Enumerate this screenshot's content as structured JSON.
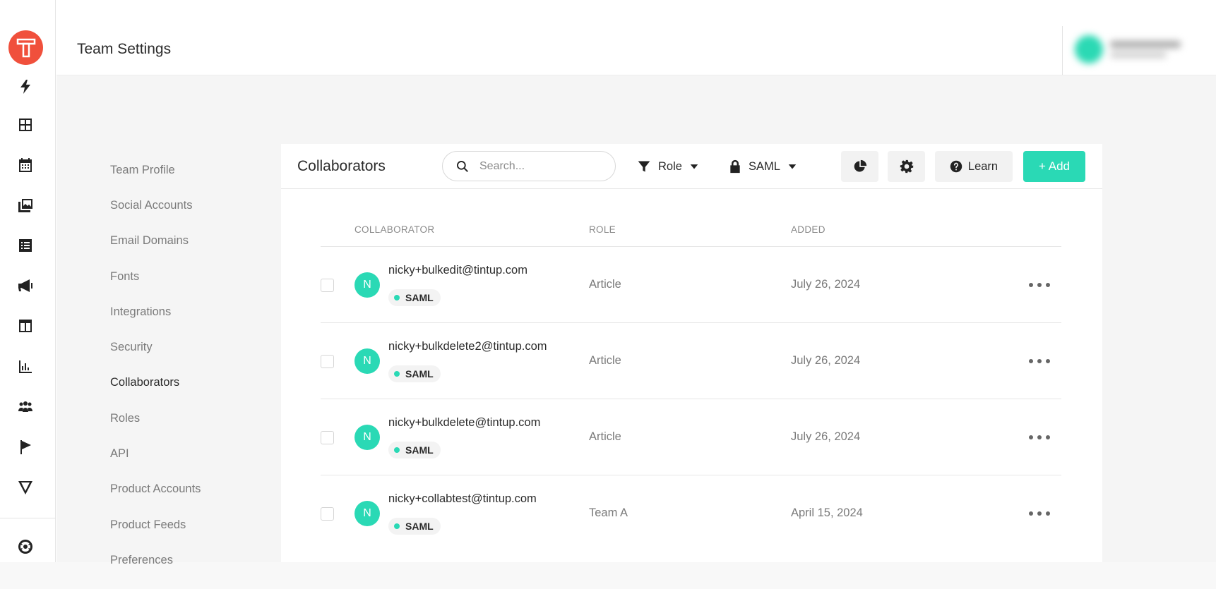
{
  "header": {
    "title": "Team Settings"
  },
  "settings_nav": [
    {
      "label": "Team Profile",
      "name": "nav-team-profile",
      "active": false
    },
    {
      "label": "Social Accounts",
      "name": "nav-social-accounts",
      "active": false
    },
    {
      "label": "Email Domains",
      "name": "nav-email-domains",
      "active": false
    },
    {
      "label": "Fonts",
      "name": "nav-fonts",
      "active": false
    },
    {
      "label": "Integrations",
      "name": "nav-integrations",
      "active": false
    },
    {
      "label": "Security",
      "name": "nav-security",
      "active": false
    },
    {
      "label": "Collaborators",
      "name": "nav-collaborators",
      "active": true
    },
    {
      "label": "Roles",
      "name": "nav-roles",
      "active": false
    },
    {
      "label": "API",
      "name": "nav-api",
      "active": false
    },
    {
      "label": "Product Accounts",
      "name": "nav-product-accounts",
      "active": false
    },
    {
      "label": "Product Feeds",
      "name": "nav-product-feeds",
      "active": false
    },
    {
      "label": "Preferences",
      "name": "nav-preferences",
      "active": false
    }
  ],
  "panel": {
    "title": "Collaborators",
    "search_placeholder": "Search...",
    "role_filter_label": "Role",
    "saml_filter_label": "SAML",
    "learn_label": "Learn",
    "add_label": "+ Add"
  },
  "table": {
    "columns": [
      "COLLABORATOR",
      "ROLE",
      "ADDED"
    ],
    "rows": [
      {
        "initial": "N",
        "email": "nicky+bulkedit@tintup.com",
        "badge": "SAML",
        "role": "Article",
        "added": "July 26, 2024"
      },
      {
        "initial": "N",
        "email": "nicky+bulkdelete2@tintup.com",
        "badge": "SAML",
        "role": "Article",
        "added": "July 26, 2024"
      },
      {
        "initial": "N",
        "email": "nicky+bulkdelete@tintup.com",
        "badge": "SAML",
        "role": "Article",
        "added": "July 26, 2024"
      },
      {
        "initial": "N",
        "email": "nicky+collabtest@tintup.com",
        "badge": "SAML",
        "role": "Team A",
        "added": "April 15, 2024"
      }
    ]
  },
  "rail_icons": [
    "bolt-icon",
    "grid-icon",
    "calendar-icon",
    "media-library-icon",
    "list-icon",
    "megaphone-icon",
    "layout-icon",
    "analytics-icon",
    "team-icon",
    "flag-icon",
    "triangle-icon",
    "help-lifebuoy-icon"
  ],
  "colors": {
    "accent": "#2ad9b5",
    "logo": "#f0503c",
    "background": "#f5f5f5"
  }
}
